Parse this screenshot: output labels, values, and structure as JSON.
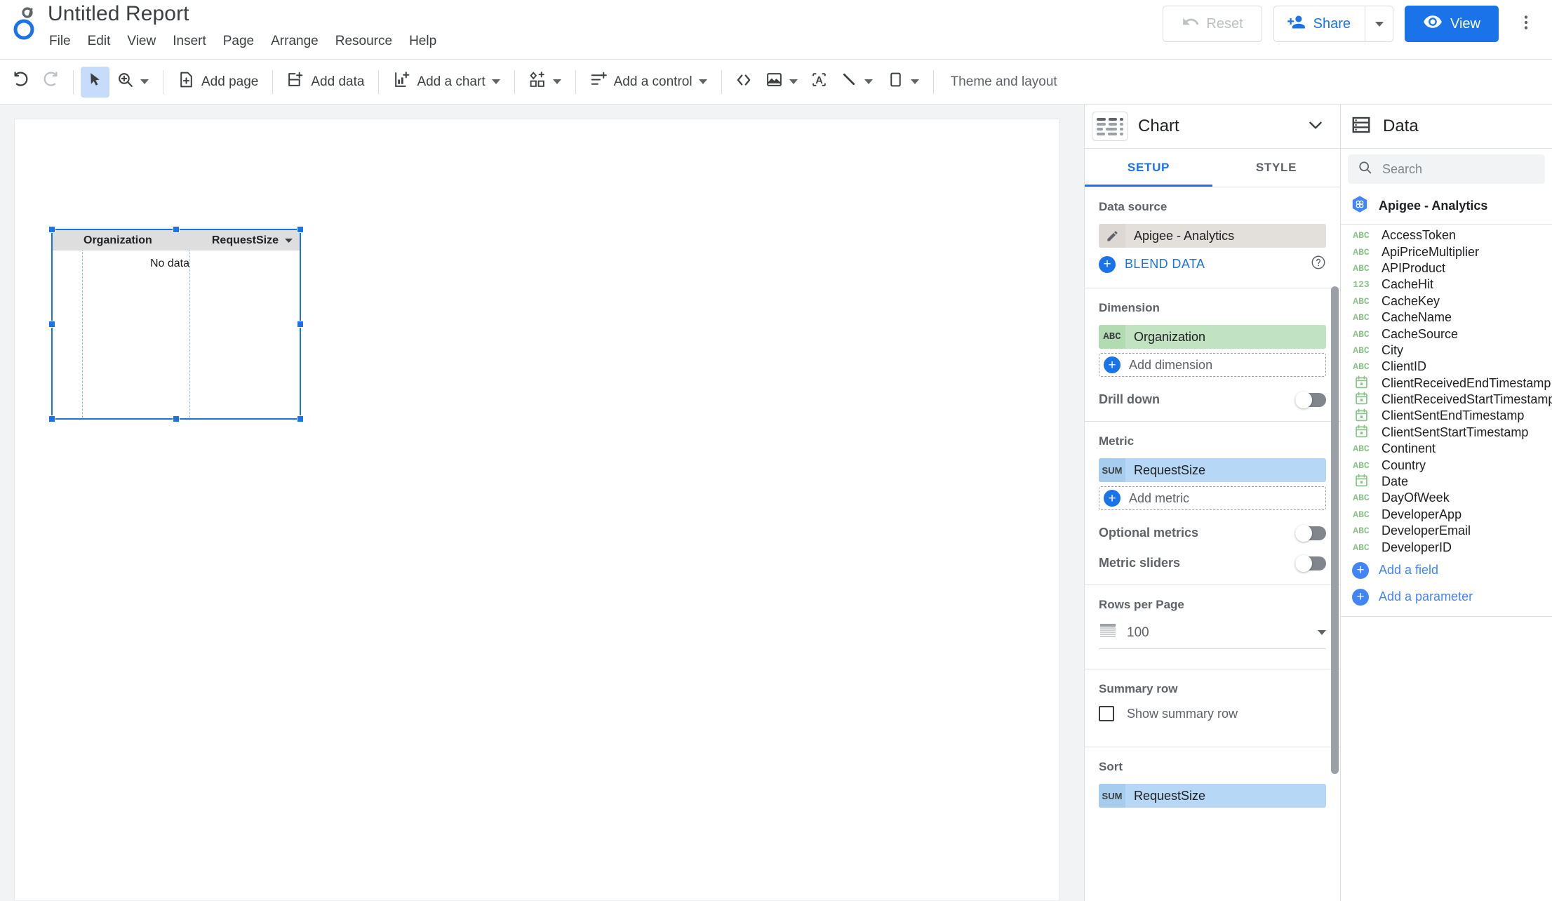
{
  "app": {
    "title": "Untitled Report",
    "logo_name": "looker-studio-logo"
  },
  "menubar": [
    {
      "label": "File"
    },
    {
      "label": "Edit"
    },
    {
      "label": "View"
    },
    {
      "label": "Insert"
    },
    {
      "label": "Page"
    },
    {
      "label": "Arrange"
    },
    {
      "label": "Resource"
    },
    {
      "label": "Help"
    }
  ],
  "topright": {
    "reset_label": "Reset",
    "share_label": "Share",
    "view_label": "View",
    "more_label": "",
    "accent_color": "#1a73e8",
    "reset_disabled_color": "#bdc1c6"
  },
  "toolbar": {
    "undo_label": "",
    "redo_label": "",
    "select_label": "",
    "zoom_label": "",
    "add_page_label": "Add page",
    "add_data_label": "Add data",
    "add_chart_label": "Add a chart",
    "add_community_viz_label": "",
    "add_control_label": "Add a control",
    "embed_label": "",
    "image_label": "",
    "text_label": "",
    "line_label": "",
    "shape_label": "",
    "theme_layout_label": "Theme and layout"
  },
  "canvas": {
    "table": {
      "columns": [
        {
          "label": "Organization",
          "align": "left",
          "sort_indicator": false
        },
        {
          "label": "RequestSize",
          "align": "right",
          "sort_indicator": true
        }
      ],
      "rows": [],
      "empty_message": "No data",
      "selected": true,
      "selection_color": "#1a73e8",
      "header_bg": "#dedede"
    }
  },
  "setup_panel": {
    "header_title": "Chart",
    "chart_type_icon": "table-chart-icon",
    "tabs": [
      {
        "label": "SETUP",
        "active": true
      },
      {
        "label": "STYLE",
        "active": false
      }
    ],
    "data_source": {
      "section_title": "Data source",
      "name": "Apigee - Analytics",
      "edit_icon": "pencil-icon",
      "blend_data_label": "BLEND DATA",
      "help_icon": "help-circle-icon"
    },
    "dimension": {
      "section_title": "Dimension",
      "chips": [
        {
          "type": "ABC",
          "label": "Organization"
        }
      ],
      "add_label": "Add dimension",
      "drill_down_label": "Drill down",
      "drill_down_on": false
    },
    "metric": {
      "section_title": "Metric",
      "chips": [
        {
          "type": "SUM",
          "label": "RequestSize"
        }
      ],
      "add_label": "Add metric",
      "optional_metrics_label": "Optional metrics",
      "optional_metrics_on": false,
      "metric_sliders_label": "Metric sliders",
      "metric_sliders_on": false
    },
    "rows_per_page": {
      "section_title": "Rows per Page",
      "value": "100",
      "icon": "rows-icon"
    },
    "summary_row": {
      "section_title": "Summary row",
      "checkbox_label": "Show summary row",
      "checked": false
    },
    "sort": {
      "section_title": "Sort",
      "chips": [
        {
          "type": "SUM",
          "label": "RequestSize"
        }
      ]
    }
  },
  "data_panel": {
    "header_title": "Data",
    "header_icon": "data-list-icon",
    "search": {
      "placeholder": "Search",
      "value": "",
      "icon": "search-icon"
    },
    "data_source": {
      "name": "Apigee - Analytics",
      "icon": "apigee-hex-icon"
    },
    "fields": [
      {
        "type": "ABC",
        "name": "AccessToken"
      },
      {
        "type": "ABC",
        "name": "ApiPriceMultiplier"
      },
      {
        "type": "ABC",
        "name": "APIProduct"
      },
      {
        "type": "123",
        "name": "CacheHit"
      },
      {
        "type": "ABC",
        "name": "CacheKey"
      },
      {
        "type": "ABC",
        "name": "CacheName"
      },
      {
        "type": "ABC",
        "name": "CacheSource"
      },
      {
        "type": "ABC",
        "name": "City"
      },
      {
        "type": "ABC",
        "name": "ClientID"
      },
      {
        "type": "DATE",
        "name": "ClientReceivedEndTimestamp"
      },
      {
        "type": "DATE",
        "name": "ClientReceivedStartTimestamp"
      },
      {
        "type": "DATE",
        "name": "ClientSentEndTimestamp"
      },
      {
        "type": "DATE",
        "name": "ClientSentStartTimestamp"
      },
      {
        "type": "ABC",
        "name": "Continent"
      },
      {
        "type": "ABC",
        "name": "Country"
      },
      {
        "type": "DATE",
        "name": "Date"
      },
      {
        "type": "ABC",
        "name": "DayOfWeek"
      },
      {
        "type": "ABC",
        "name": "DeveloperApp"
      },
      {
        "type": "ABC",
        "name": "DeveloperEmail"
      },
      {
        "type": "ABC",
        "name": "DeveloperID"
      }
    ],
    "add_field_label": "Add a field",
    "add_parameter_label": "Add a parameter"
  }
}
